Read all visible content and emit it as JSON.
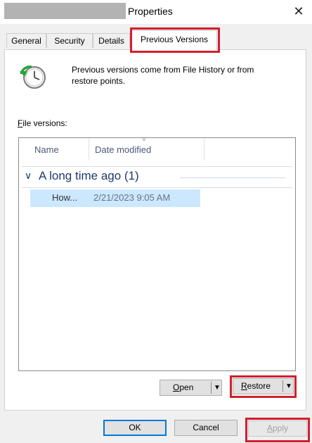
{
  "window": {
    "title": "Properties",
    "close_glyph": "✕"
  },
  "tabs": [
    {
      "label": "General"
    },
    {
      "label": "Security"
    },
    {
      "label": "Details"
    },
    {
      "label": "Previous Versions",
      "active": true
    }
  ],
  "panel": {
    "icon": "clock-restore-icon",
    "info_text": "Previous versions come from File History or from restore points.",
    "file_versions_label": {
      "hotkey": "F",
      "rest": "ile versions:"
    }
  },
  "list": {
    "columns": [
      "Name",
      "Date modified"
    ],
    "sort_indicator": "˅",
    "group": {
      "chevron": "∨",
      "label": "A long time ago (1)"
    },
    "items": [
      {
        "name": "How...",
        "date_modified": "2/21/2023 9:05 AM",
        "selected": true
      }
    ]
  },
  "buttons": {
    "open": {
      "hotkey": "O",
      "rest": "pen",
      "arrow": "▼"
    },
    "restore": {
      "hotkey": "R",
      "rest": "estore",
      "arrow": "▼"
    },
    "ok": "OK",
    "cancel": "Cancel",
    "apply": {
      "hotkey": "A",
      "rest": "pply"
    }
  },
  "colors": {
    "highlight": "#d0202c",
    "selection": "#cce8ff",
    "group_text": "#1e3a6e",
    "ok_border": "#0078d7"
  }
}
